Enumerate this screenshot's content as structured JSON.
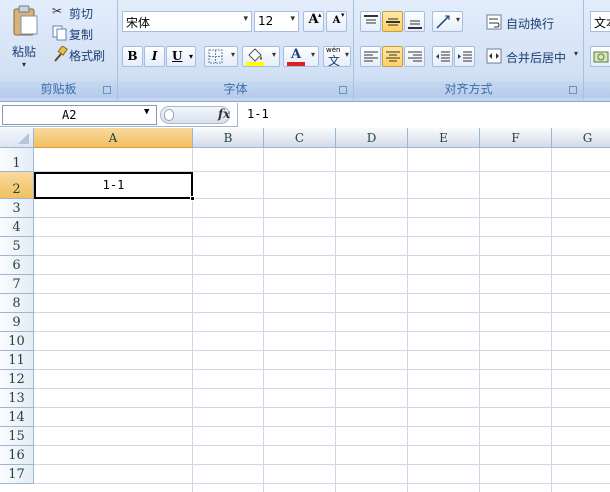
{
  "clipboard": {
    "paste": "粘贴",
    "cut": "剪切",
    "copy": "复制",
    "format_painter": "格式刷",
    "group": "剪贴板"
  },
  "font": {
    "name": "宋体",
    "size": "12",
    "bold": "B",
    "italic": "I",
    "underline": "U",
    "font_color_glyph": "A",
    "grow_glyph": "A",
    "shrink_glyph": "A",
    "wen_top": "wén",
    "wen": "文",
    "group": "字体"
  },
  "align": {
    "wrap": "自动换行",
    "merge": "合并后居中",
    "group": "对齐方式"
  },
  "number": {
    "format": "文本"
  },
  "formula_bar": {
    "cell_ref": "A2",
    "fx": "fx",
    "value": "1-1"
  },
  "grid": {
    "columns": [
      "A",
      "B",
      "C",
      "D",
      "E",
      "F",
      "G"
    ],
    "rows": [
      "1",
      "2",
      "3",
      "4",
      "5",
      "6",
      "7",
      "8",
      "9",
      "10",
      "11",
      "12",
      "13",
      "14",
      "15",
      "16",
      "17"
    ],
    "active_column": "A",
    "active_row": "2",
    "cells": {
      "A2": "1-1"
    }
  },
  "colors": {
    "font_color": "#e02020",
    "highlight": "#ffff00",
    "active_header": "#f1c15f"
  }
}
